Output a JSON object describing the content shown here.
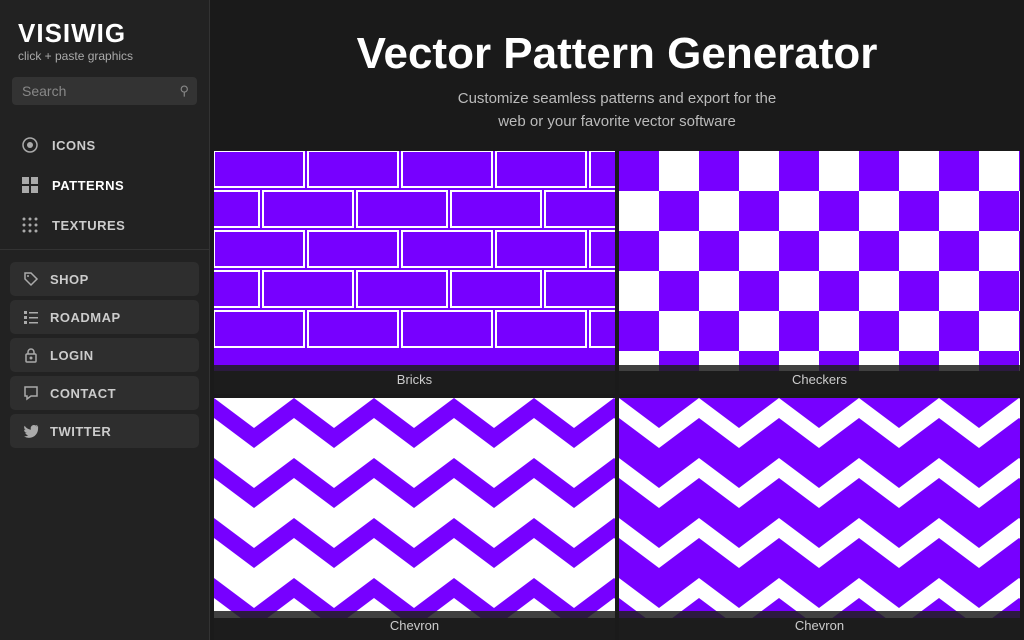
{
  "sidebar": {
    "logo": {
      "title": "VISIWIG",
      "subtitle": "click + paste graphics"
    },
    "search": {
      "placeholder": "Search",
      "label": "Search"
    },
    "nav_items": [
      {
        "id": "icons",
        "label": "ICONS",
        "icon": "settings-icon"
      },
      {
        "id": "patterns",
        "label": "PATTERNS",
        "icon": "grid-icon",
        "active": true
      },
      {
        "id": "textures",
        "label": "TEXTURES",
        "icon": "texture-icon"
      }
    ],
    "buttons": [
      {
        "id": "shop",
        "label": "SHOP",
        "icon": "tag-icon"
      },
      {
        "id": "roadmap",
        "label": "ROADMAP",
        "icon": "list-icon"
      },
      {
        "id": "login",
        "label": "LOGIN",
        "icon": "lock-icon"
      },
      {
        "id": "contact",
        "label": "CONTACT",
        "icon": "chat-icon"
      },
      {
        "id": "twitter",
        "label": "TWITTER",
        "icon": "twitter-icon"
      }
    ]
  },
  "main": {
    "title": "Vector Pattern Generator",
    "subtitle_line1": "Customize seamless patterns and export for the",
    "subtitle_line2": "web or your favorite vector software",
    "patterns": [
      {
        "id": "bricks",
        "label": "Bricks",
        "type": "bricks"
      },
      {
        "id": "checkers",
        "label": "Checkers",
        "type": "checkers"
      },
      {
        "id": "chevron-left",
        "label": "Chevron",
        "type": "chevron-white"
      },
      {
        "id": "chevron-right",
        "label": "Chevron",
        "type": "chevron-purple"
      }
    ]
  },
  "colors": {
    "purple": "#7700ff",
    "white": "#ffffff",
    "dark_bg": "#1a1a1a",
    "sidebar_bg": "#222222"
  }
}
